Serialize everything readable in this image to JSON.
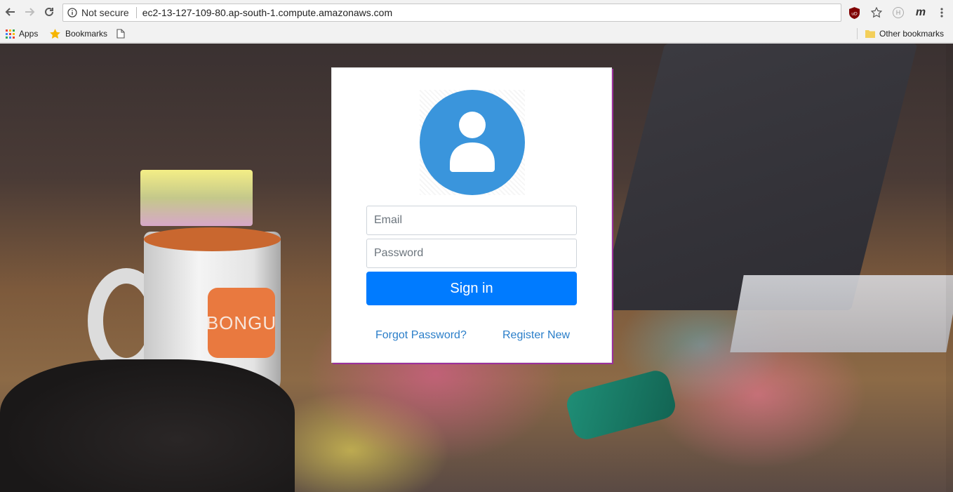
{
  "browser": {
    "security_label": "Not secure",
    "url": "ec2-13-127-109-80.ap-south-1.compute.amazonaws.com",
    "bookmarks": {
      "apps": "Apps",
      "bookmarks": "Bookmarks",
      "other": "Other bookmarks"
    },
    "extensions": {
      "ublock_label": "uD",
      "hover_label": "H",
      "m_label": "m"
    }
  },
  "mug": {
    "logo_text": "BONGU"
  },
  "login": {
    "email_placeholder": "Email",
    "password_placeholder": "Password",
    "signin_label": "Sign in",
    "forgot_label": "Forgot Password?",
    "register_label": "Register New"
  },
  "colors": {
    "primary_button": "#007bff",
    "avatar": "#3a95dc",
    "link": "#2a7ec9",
    "card_shadow": "#9b2f9b"
  }
}
